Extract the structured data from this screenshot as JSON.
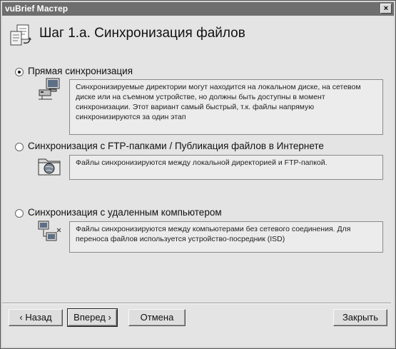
{
  "window": {
    "title": "vuBrief Мастер",
    "close_label": "×"
  },
  "header": {
    "title": "Шаг 1.а. Синхронизация файлов",
    "icon": "sync-files-icon"
  },
  "options": [
    {
      "label": "Прямая синхронизация",
      "selected": true,
      "icon": "computer-disk-icon",
      "description": "Синхронизируемые директории могут находится на локальном диске, на сетевом диске или на съемном устройстве, но должны быть доступны в момент синхронизации. Этот вариант самый быстрый, т.к. файлы напрямую синхронизируются за один этап"
    },
    {
      "label": "Синхронизация с FTP-папками / Публикация файлов в Интернете",
      "selected": false,
      "icon": "ftp-globe-folder-icon",
      "description": "Файлы синхронизируются между локальной директорией и FTP-папкой."
    },
    {
      "label": "Синхронизация с удаленным компьютером",
      "selected": false,
      "icon": "remote-computer-icon",
      "description": "Файлы синхронизируются между компьютерами без сетевого соединения. Для переноса файлов используется устройство-посредник (ISD)"
    }
  ],
  "buttons": {
    "back": "‹ Назад",
    "next": "Вперед ›",
    "cancel": "Отмена",
    "close": "Закрыть"
  }
}
